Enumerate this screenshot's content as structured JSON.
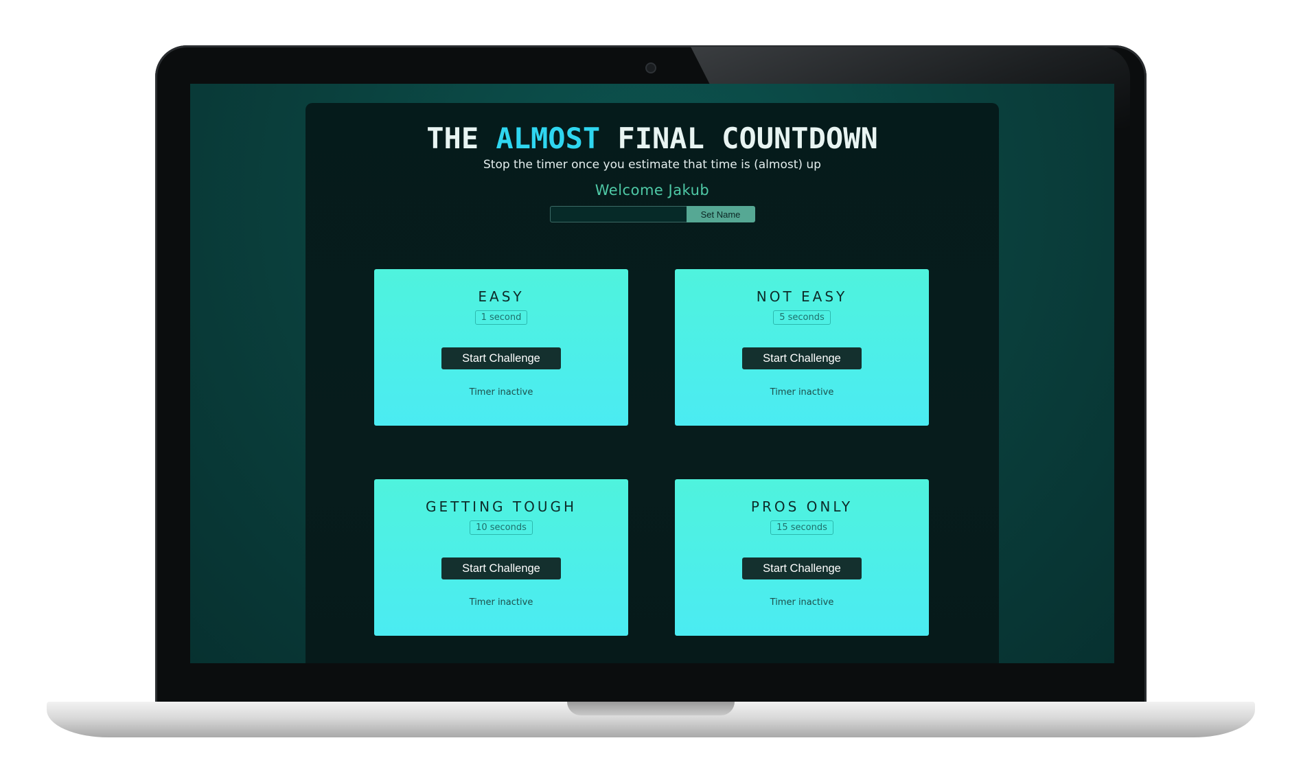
{
  "header": {
    "title_prefix": "THE",
    "title_accent": "ALMOST",
    "title_suffix": "FINAL COUNTDOWN",
    "subtitle": "Stop the timer once you estimate that time is (almost) up",
    "welcome": "Welcome Jakub"
  },
  "name_form": {
    "input_value": "",
    "input_placeholder": "",
    "button_label": "Set Name"
  },
  "challenges": [
    {
      "title": "EASY",
      "duration": "1 second",
      "button_label": "Start Challenge",
      "status": "Timer inactive"
    },
    {
      "title": "NOT EASY",
      "duration": "5 seconds",
      "button_label": "Start Challenge",
      "status": "Timer inactive"
    },
    {
      "title": "GETTING TOUGH",
      "duration": "10 seconds",
      "button_label": "Start Challenge",
      "status": "Timer inactive"
    },
    {
      "title": "PROS ONLY",
      "duration": "15 seconds",
      "button_label": "Start Challenge",
      "status": "Timer inactive"
    }
  ],
  "colors": {
    "accent": "#2fd6f0",
    "card_gradient_top": "#4ff3dd",
    "card_gradient_bottom": "#4bebf2",
    "button_bg": "#14302e",
    "welcome_text": "#4fc9a6",
    "panel_bg": "#061a1a",
    "screen_bg": "#0a3f3c"
  }
}
